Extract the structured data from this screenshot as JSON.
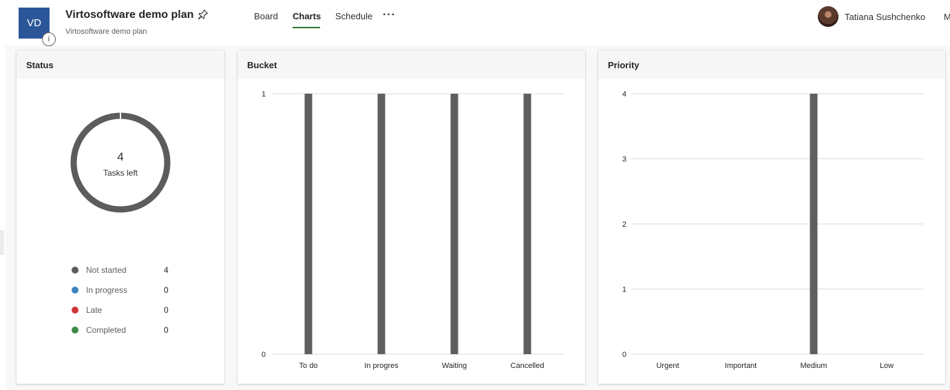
{
  "header": {
    "tile_initials": "VD",
    "info_glyph": "i",
    "title": "Virtosoftware demo plan",
    "subtitle": "Virtosoftware demo plan",
    "tabs": [
      {
        "label": "Board",
        "active": false
      },
      {
        "label": "Charts",
        "active": true
      },
      {
        "label": "Schedule",
        "active": false
      }
    ],
    "more_glyph": "···",
    "user_name": "Tatiana Sushchenko",
    "user_more": "M",
    "icons": [
      "pin-icon",
      "info-icon",
      "more-icon",
      "avatar"
    ]
  },
  "status": {
    "title": "Status",
    "tasks_left_count": "4",
    "tasks_left_label": "Tasks left",
    "legend": [
      {
        "label": "Not started",
        "count": "4",
        "color": "#5c5c5c"
      },
      {
        "label": "In progress",
        "count": "0",
        "color": "#3a83c1"
      },
      {
        "label": "Late",
        "count": "0",
        "color": "#d13438"
      },
      {
        "label": "Completed",
        "count": "0",
        "color": "#3d8a42"
      }
    ]
  },
  "bucket": {
    "title": "Bucket"
  },
  "priority": {
    "title": "Priority"
  },
  "colors": {
    "bar": "#5f5f5f",
    "grid": "#d9d9d9",
    "tab_underline": "#31752f",
    "tile": "#2b579a"
  },
  "chart_data": [
    {
      "type": "bar",
      "title": "Bucket",
      "categories": [
        "To do",
        "In progres",
        "Waiting",
        "Cancelled"
      ],
      "values": [
        1,
        1,
        1,
        1
      ],
      "yticks": [
        0,
        1
      ],
      "ylim": [
        0,
        1
      ],
      "grid": true
    },
    {
      "type": "bar",
      "title": "Priority",
      "categories": [
        "Urgent",
        "Important",
        "Medium",
        "Low"
      ],
      "values": [
        0,
        0,
        4,
        0
      ],
      "yticks": [
        0,
        1,
        2,
        3,
        4
      ],
      "ylim": [
        0,
        4
      ],
      "grid": true
    }
  ]
}
